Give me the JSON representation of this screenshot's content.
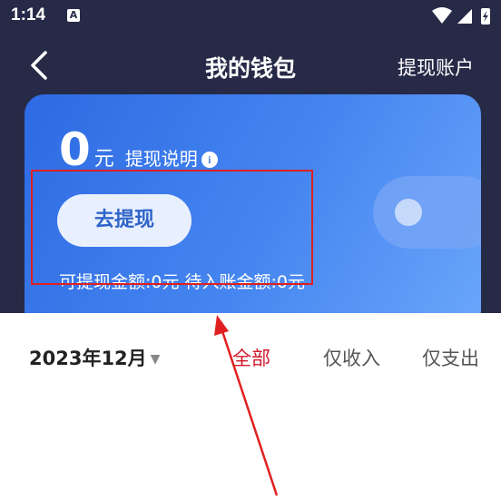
{
  "status_bar": {
    "time": "1:14",
    "notification_icon": "A"
  },
  "navbar": {
    "title": "我的钱包",
    "right_action": "提现账户"
  },
  "wallet_card": {
    "amount": "0",
    "unit": "元",
    "explain_link": "提现说明",
    "info_icon": "i",
    "withdraw_button": "去提现",
    "balance_line": "可提现金额:0元  待入账金额:0元"
  },
  "filter": {
    "month": "2023年12月",
    "tabs": [
      {
        "label": "全部",
        "active": true
      },
      {
        "label": "仅收入",
        "active": false
      },
      {
        "label": "仅支出",
        "active": false
      }
    ]
  },
  "colors": {
    "header_bg": "#272a47",
    "card_gradient_start": "#2d6ae3",
    "card_gradient_end": "#6aa6fb",
    "active_tab": "#d0182a",
    "annotation": "#e02020"
  }
}
